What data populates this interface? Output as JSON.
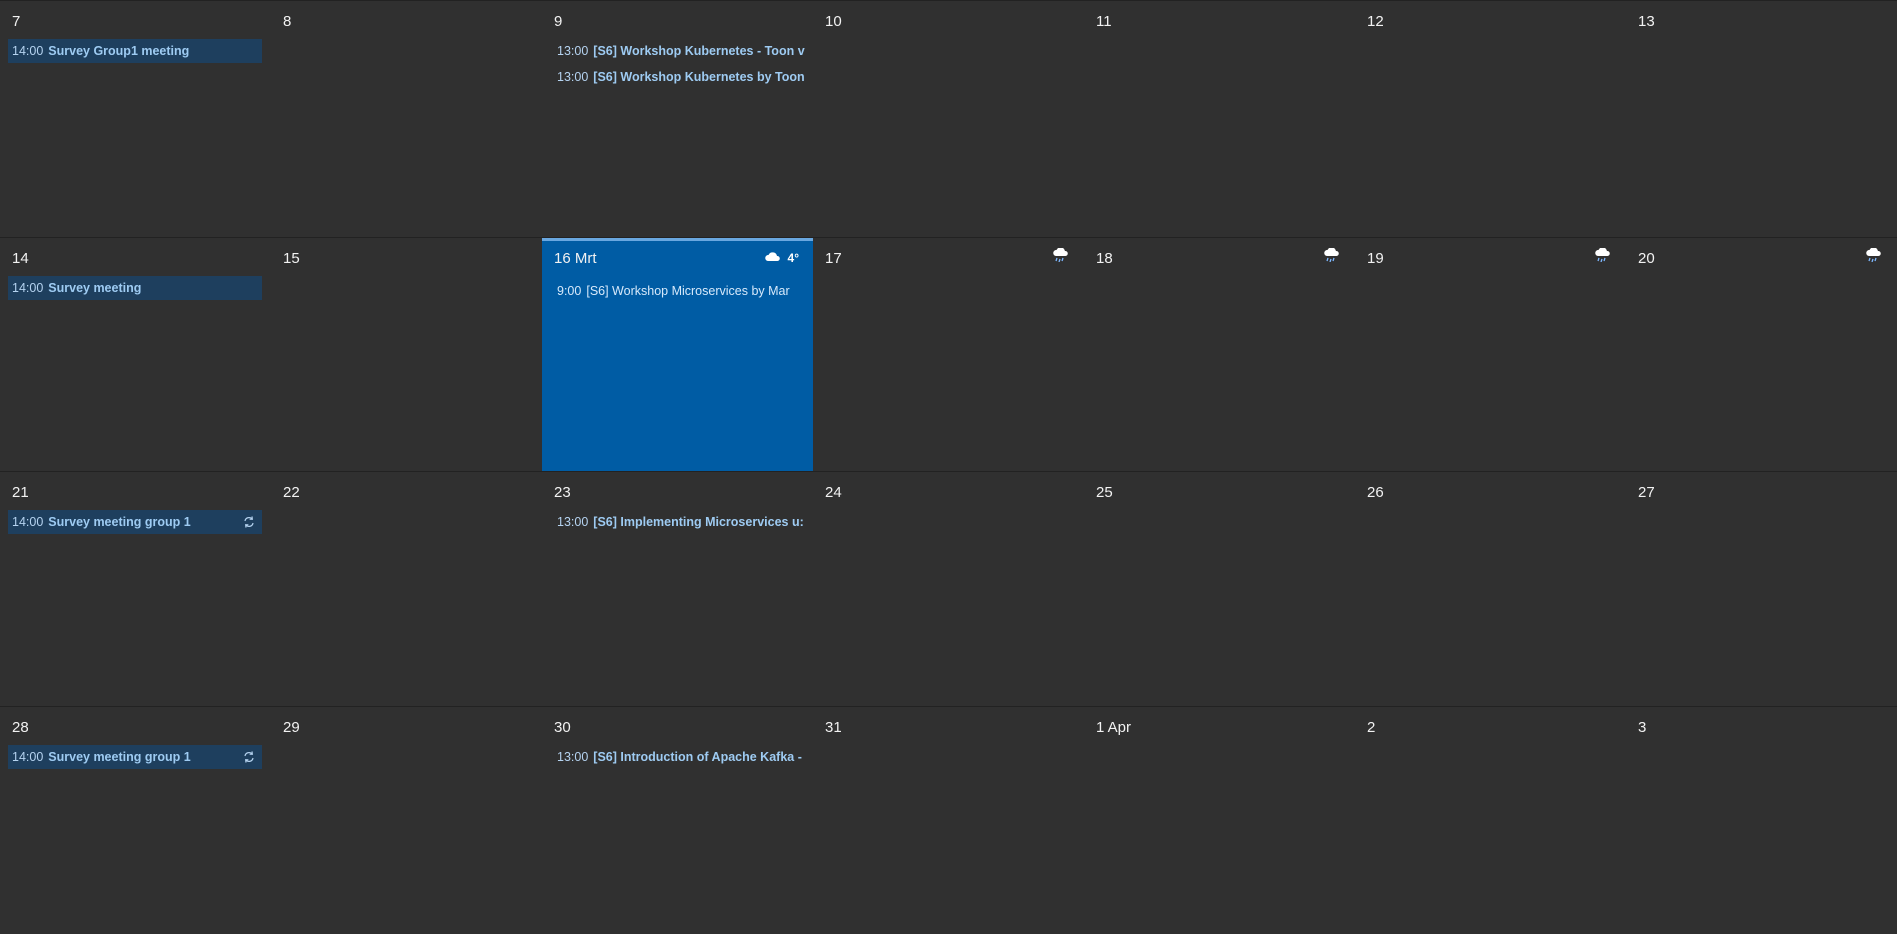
{
  "weeks": [
    {
      "days": [
        {
          "label": "7",
          "events": [
            {
              "time": "14:00",
              "title": "Survey Group1 meeting",
              "style": "block"
            }
          ]
        },
        {
          "label": "8",
          "events": []
        },
        {
          "label": "9",
          "events": [
            {
              "time": "13:00",
              "title": "[S6] Workshop Kubernetes - Toon v",
              "style": "plain"
            },
            {
              "time": "13:00",
              "title": "[S6] Workshop Kubernetes by Toon",
              "style": "plain"
            }
          ]
        },
        {
          "label": "10",
          "events": []
        },
        {
          "label": "11",
          "events": []
        },
        {
          "label": "12",
          "events": []
        },
        {
          "label": "13",
          "events": []
        }
      ]
    },
    {
      "days": [
        {
          "label": "14",
          "events": [
            {
              "time": "14:00",
              "title": "Survey meeting",
              "style": "block"
            }
          ]
        },
        {
          "label": "15",
          "events": []
        },
        {
          "label": "16 Mrt",
          "today": true,
          "weather": {
            "icon": "cloud-icon",
            "temp": "4°"
          },
          "events": [
            {
              "time": "9:00",
              "title": "[S6] Workshop Microservices by Mar",
              "style": "plain"
            }
          ]
        },
        {
          "label": "17",
          "weather": {
            "icon": "rain-cloud-icon",
            "temp": ""
          },
          "events": []
        },
        {
          "label": "18",
          "weather": {
            "icon": "rain-cloud-icon",
            "temp": ""
          },
          "events": []
        },
        {
          "label": "19",
          "weather": {
            "icon": "rain-cloud-icon",
            "temp": ""
          },
          "events": []
        },
        {
          "label": "20",
          "weather": {
            "icon": "rain-cloud-icon",
            "temp": ""
          },
          "events": []
        }
      ]
    },
    {
      "days": [
        {
          "label": "21",
          "events": [
            {
              "time": "14:00",
              "title": "Survey meeting group 1",
              "style": "block",
              "recurring": true
            }
          ]
        },
        {
          "label": "22",
          "events": []
        },
        {
          "label": "23",
          "events": [
            {
              "time": "13:00",
              "title": "[S6] Implementing Microservices u:",
              "style": "plain"
            }
          ]
        },
        {
          "label": "24",
          "events": []
        },
        {
          "label": "25",
          "events": []
        },
        {
          "label": "26",
          "events": []
        },
        {
          "label": "27",
          "events": []
        }
      ]
    },
    {
      "days": [
        {
          "label": "28",
          "events": [
            {
              "time": "14:00",
              "title": "Survey meeting group 1",
              "style": "block",
              "recurring": true
            }
          ]
        },
        {
          "label": "29",
          "events": []
        },
        {
          "label": "30",
          "events": [
            {
              "time": "13:00",
              "title": "[S6] Introduction of Apache Kafka -",
              "style": "plain"
            }
          ]
        },
        {
          "label": "31",
          "events": []
        },
        {
          "label": "1 Apr",
          "events": []
        },
        {
          "label": "2",
          "events": []
        },
        {
          "label": "3",
          "events": []
        }
      ]
    }
  ],
  "colors": {
    "background": "#303030",
    "today": "#005ca4",
    "today_border": "#69a7e0",
    "event_block": "#1e3f5e",
    "event_text": "#9ecbf2"
  }
}
